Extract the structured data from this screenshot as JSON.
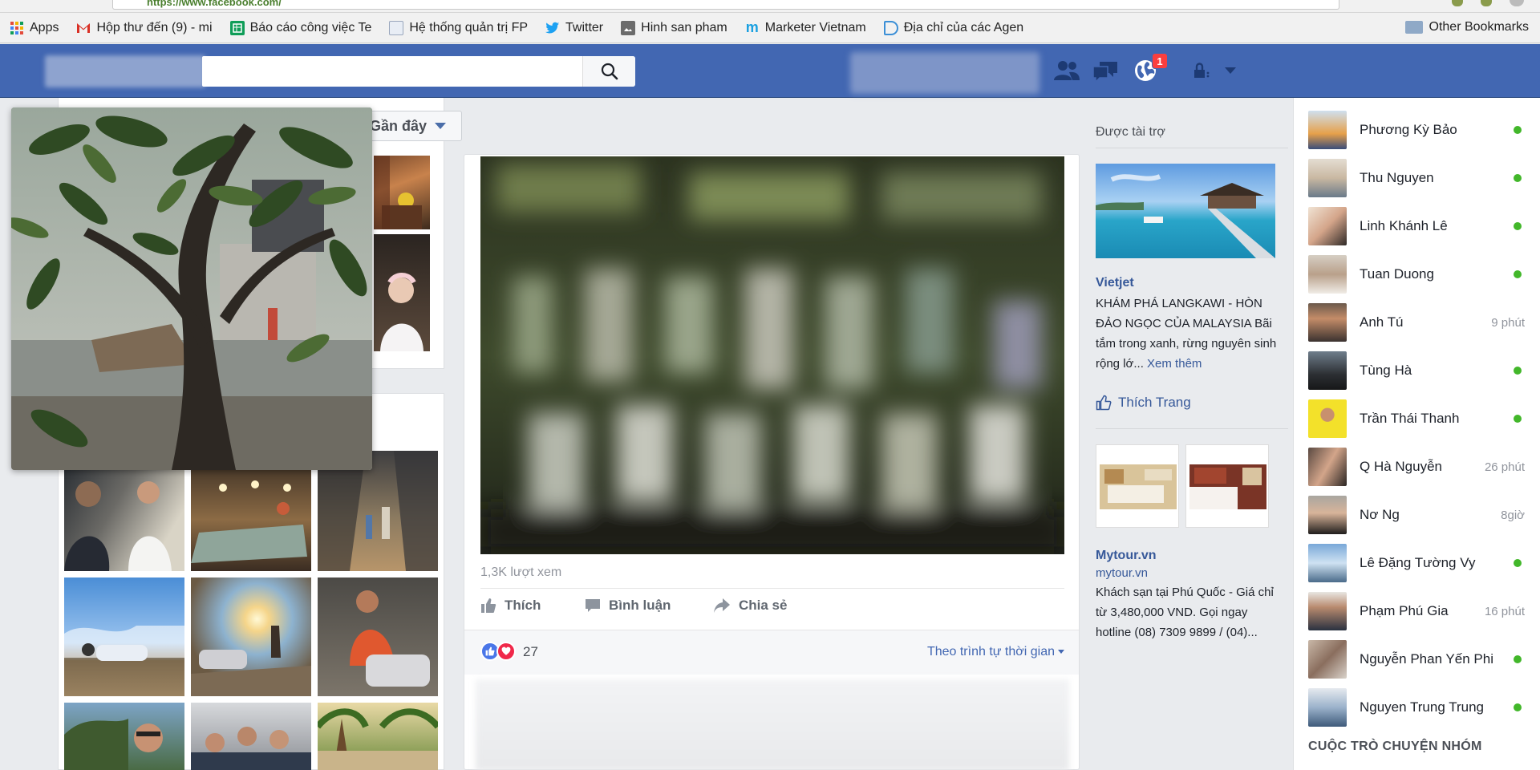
{
  "browser": {
    "url": "https://www.facebook.com/"
  },
  "bookmarks": [
    {
      "label": "Apps",
      "icon": "apps-grid-icon",
      "color": "#e34b3b"
    },
    {
      "label": "Hộp thư đến (9) - mi",
      "icon": "gmail-icon",
      "color": "#d93025"
    },
    {
      "label": "Báo cáo công việc Te",
      "icon": "sheets-icon",
      "color": "#0f9d58"
    },
    {
      "label": "Hệ thống quản trị FP",
      "icon": "page-icon",
      "color": "#9aa7bd"
    },
    {
      "label": "Twitter",
      "icon": "twitter-icon",
      "color": "#1da1f2"
    },
    {
      "label": "Hinh san pham",
      "icon": "image-icon",
      "color": "#6b6b6b"
    },
    {
      "label": "Marketer Vietnam",
      "icon": "m-logo-icon",
      "color": "#1aa0e0"
    },
    {
      "label": "Địa chỉ của các Agen",
      "icon": "d-logo-icon",
      "color": "#3b8fd6"
    }
  ],
  "other_bookmarks": "Other Bookmarks",
  "header": {
    "notification_count": "1",
    "brand_color": "#4267b2"
  },
  "feed": {
    "sort_label": "Gần đây",
    "views": "1,3K lượt xem",
    "actions": {
      "like": "Thích",
      "comment": "Bình luận",
      "share": "Chia sẻ"
    },
    "reaction_count": "27",
    "timeline_sort": "Theo trình tự thời gian"
  },
  "ads": {
    "title": "Được tài trợ",
    "ad1": {
      "brand": "Vietjet",
      "text": "KHÁM PHÁ LANGKAWI - HÒN ĐẢO NGỌC CỦA MALAYSIA Bãi tắm trong xanh, rừng nguyên sinh rộng lớ...",
      "more": "Xem thêm",
      "like_page": "Thích Trang"
    },
    "ad2": {
      "brand": "Mytour.vn",
      "domain": "mytour.vn",
      "text": "Khách sạn tại Phú Quốc - Giá chỉ từ 3,480,000 VND. Gọi ngay hotline (08) 7309 9899 / (04)..."
    }
  },
  "chat": {
    "contacts": [
      {
        "name": "Phương Kỳ Bảo",
        "status": "online"
      },
      {
        "name": "Thu Nguyen",
        "status": "online"
      },
      {
        "name": "Linh Khánh Lê",
        "status": "online"
      },
      {
        "name": "Tuan Duong",
        "status": "online"
      },
      {
        "name": "Anh Tú",
        "status": "9 phút"
      },
      {
        "name": "Tùng Hà",
        "status": "online"
      },
      {
        "name": "Trần Thái Thanh",
        "status": "online"
      },
      {
        "name": "Q Hà Nguyễn",
        "status": "26 phút"
      },
      {
        "name": "Nơ Ng",
        "status": "8giờ"
      },
      {
        "name": "Lê Đặng Tường Vy",
        "status": "online"
      },
      {
        "name": "Phạm Phú Gia",
        "status": "16 phút"
      },
      {
        "name": "Nguyễn Phan Yến Phi",
        "status": "online"
      },
      {
        "name": "Nguyen Trung Trung",
        "status": "online"
      }
    ],
    "group_section": "CUỘC TRÒ CHUYỆN NHÓM"
  }
}
